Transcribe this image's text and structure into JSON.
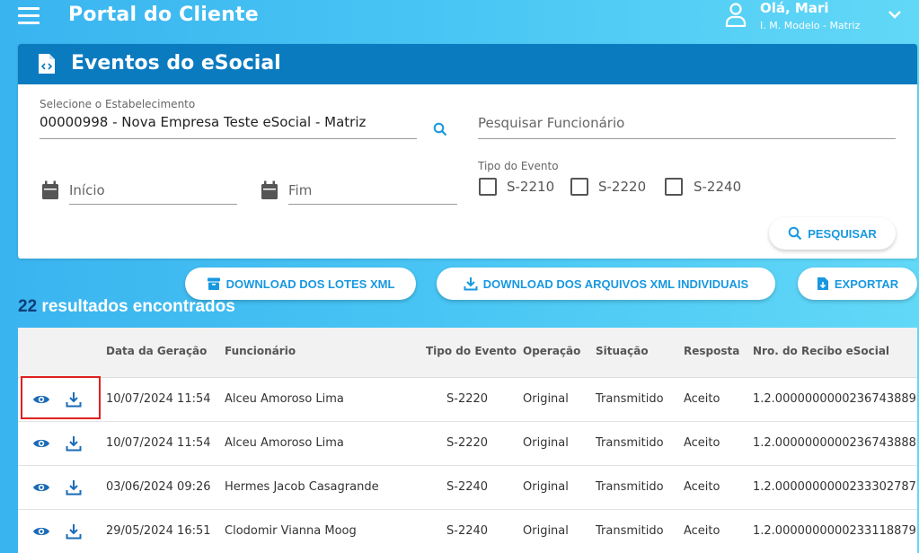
{
  "header": {
    "title": "Portal do Cliente",
    "user_greeting": "Olá, Mari",
    "user_company": "I. M. Modelo - Matriz"
  },
  "card": {
    "title": "Eventos do eSocial",
    "establishment_label": "Selecione o Estabelecimento",
    "establishment_value": "00000998 - Nova Empresa Teste eSocial - Matriz",
    "employee_placeholder": "Pesquisar Funcionário",
    "start_placeholder": "Início",
    "end_placeholder": "Fim",
    "event_type_label": "Tipo do Evento",
    "event_types": [
      "S-2210",
      "S-2220",
      "S-2240"
    ],
    "search_button": "PESQUISAR"
  },
  "actions": {
    "download_batches": "DOWNLOAD DOS LOTES XML",
    "download_individual": "DOWNLOAD DOS ARQUIVOS XML INDIVIDUAIS",
    "export": "EXPORTAR"
  },
  "results": {
    "count": "22",
    "text": "resultados encontrados"
  },
  "table": {
    "columns": [
      "Data da Geração",
      "Funcionário",
      "Tipo do Evento",
      "Operação",
      "Situação",
      "Resposta",
      "Nro. do Recibo eSocial"
    ],
    "rows": [
      {
        "date": "10/07/2024 11:54",
        "employee": "Alceu Amoroso Lima",
        "type": "S-2220",
        "operation": "Original",
        "status": "Transmitido",
        "response": "Aceito",
        "receipt": "1.2.0000000000236743889"
      },
      {
        "date": "10/07/2024 11:54",
        "employee": "Alceu Amoroso Lima",
        "type": "S-2220",
        "operation": "Original",
        "status": "Transmitido",
        "response": "Aceito",
        "receipt": "1.2.0000000000236743888"
      },
      {
        "date": "03/06/2024 09:26",
        "employee": "Hermes Jacob Casagrande",
        "type": "S-2240",
        "operation": "Original",
        "status": "Transmitido",
        "response": "Aceito",
        "receipt": "1.2.0000000000233302787"
      },
      {
        "date": "29/05/2024 16:51",
        "employee": "Clodomir Vianna Moog",
        "type": "S-2240",
        "operation": "Original",
        "status": "Transmitido",
        "response": "Aceito",
        "receipt": "1.2.0000000000233118879"
      }
    ]
  },
  "colors": {
    "accent": "#1898e0",
    "header_bar": "#0b7bc0",
    "highlight": "#e02020"
  }
}
